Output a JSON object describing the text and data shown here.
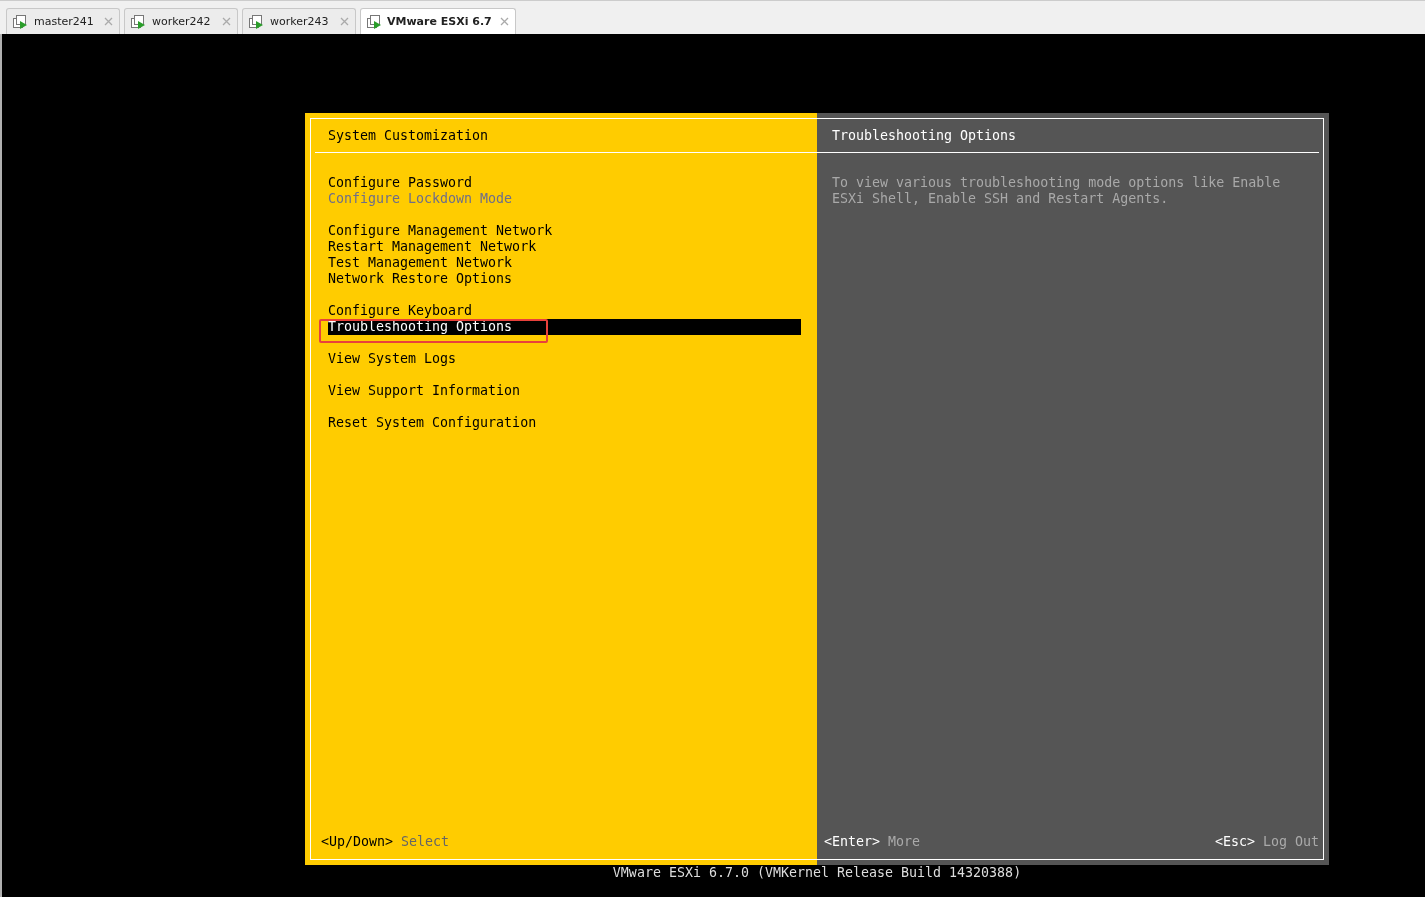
{
  "tabs": [
    {
      "label": "master241",
      "selected": false
    },
    {
      "label": "worker242",
      "selected": false
    },
    {
      "label": "worker243",
      "selected": false
    },
    {
      "label": "VMware ESXi 6.7",
      "selected": true
    }
  ],
  "menu": {
    "title": "System Customization",
    "groups": [
      [
        {
          "label": "Configure Password",
          "disabled": false,
          "selected": false,
          "annotated": false
        },
        {
          "label": "Configure Lockdown Mode",
          "disabled": true,
          "selected": false,
          "annotated": false
        }
      ],
      [
        {
          "label": "Configure Management Network",
          "disabled": false,
          "selected": false,
          "annotated": false
        },
        {
          "label": "Restart Management Network",
          "disabled": false,
          "selected": false,
          "annotated": false
        },
        {
          "label": "Test Management Network",
          "disabled": false,
          "selected": false,
          "annotated": false
        },
        {
          "label": "Network Restore Options",
          "disabled": false,
          "selected": false,
          "annotated": false
        }
      ],
      [
        {
          "label": "Configure Keyboard",
          "disabled": false,
          "selected": false,
          "annotated": false
        },
        {
          "label": "Troubleshooting Options",
          "disabled": false,
          "selected": true,
          "annotated": true
        }
      ],
      [
        {
          "label": "View System Logs",
          "disabled": false,
          "selected": false,
          "annotated": false
        }
      ],
      [
        {
          "label": "View Support Information",
          "disabled": false,
          "selected": false,
          "annotated": false
        }
      ],
      [
        {
          "label": "Reset System Configuration",
          "disabled": false,
          "selected": false,
          "annotated": false
        }
      ]
    ],
    "hints": [
      {
        "key": "<Up/Down>",
        "action": "Select"
      }
    ]
  },
  "details": {
    "title": "Troubleshooting Options",
    "description": "To view various troubleshooting mode options like Enable ESXi Shell, Enable SSH and Restart Agents.",
    "hints": [
      {
        "key": "<Enter>",
        "action": "More"
      },
      {
        "key": "<Esc>",
        "action": "Log Out"
      }
    ]
  },
  "build_line": "VMware ESXi 6.7.0 (VMKernel Release Build 14320388)"
}
